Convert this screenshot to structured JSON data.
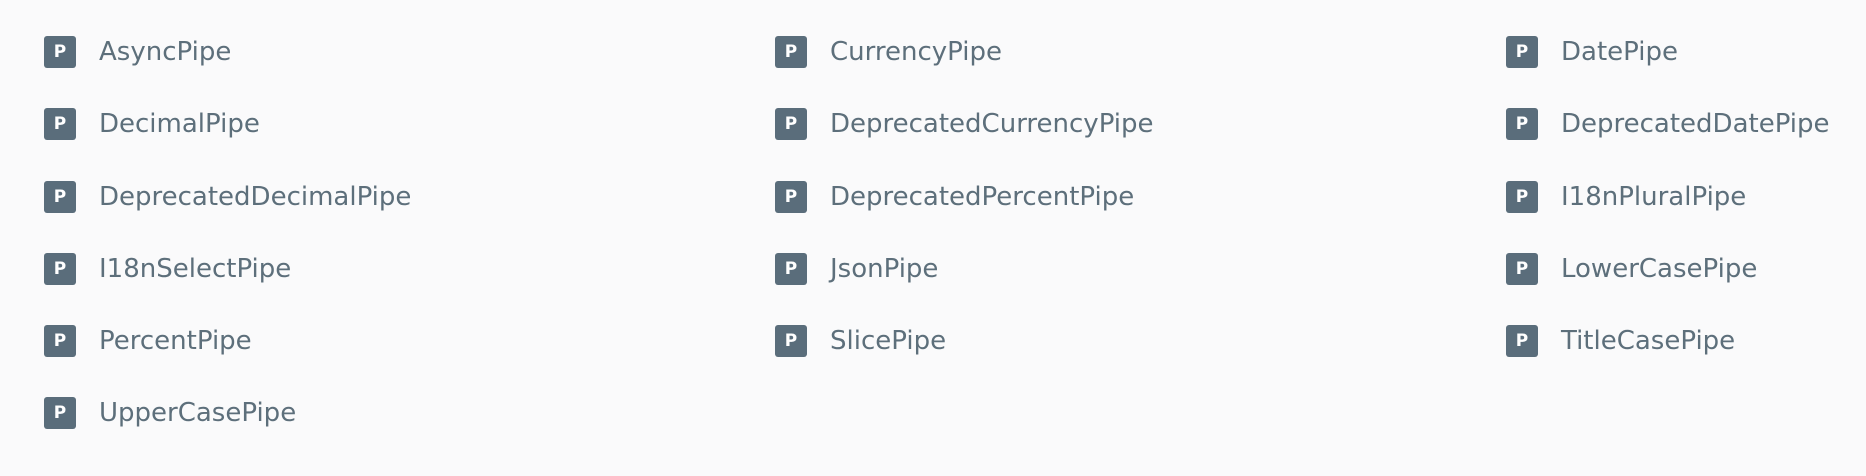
{
  "badge_letter": "P",
  "colors": {
    "background": "#fafafb",
    "badge": "#5a6d7b",
    "badge_text": "#ffffff",
    "label": "#5d6f7b"
  },
  "api_items": [
    {
      "label": "AsyncPipe",
      "icon": "pipe-badge-icon"
    },
    {
      "label": "CurrencyPipe",
      "icon": "pipe-badge-icon"
    },
    {
      "label": "DatePipe",
      "icon": "pipe-badge-icon"
    },
    {
      "label": "DecimalPipe",
      "icon": "pipe-badge-icon"
    },
    {
      "label": "DeprecatedCurrencyPipe",
      "icon": "pipe-badge-icon"
    },
    {
      "label": "DeprecatedDatePipe",
      "icon": "pipe-badge-icon"
    },
    {
      "label": "DeprecatedDecimalPipe",
      "icon": "pipe-badge-icon"
    },
    {
      "label": "DeprecatedPercentPipe",
      "icon": "pipe-badge-icon"
    },
    {
      "label": "I18nPluralPipe",
      "icon": "pipe-badge-icon"
    },
    {
      "label": "I18nSelectPipe",
      "icon": "pipe-badge-icon"
    },
    {
      "label": "JsonPipe",
      "icon": "pipe-badge-icon"
    },
    {
      "label": "LowerCasePipe",
      "icon": "pipe-badge-icon"
    },
    {
      "label": "PercentPipe",
      "icon": "pipe-badge-icon"
    },
    {
      "label": "SlicePipe",
      "icon": "pipe-badge-icon"
    },
    {
      "label": "TitleCasePipe",
      "icon": "pipe-badge-icon"
    },
    {
      "label": "UpperCasePipe",
      "icon": "pipe-badge-icon"
    }
  ]
}
